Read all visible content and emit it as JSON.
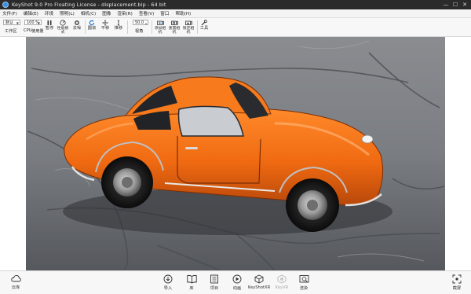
{
  "window": {
    "title": "KeyShot 9.0 Pro Floating License  -  displacement.bip  -  64 bit",
    "controls": [
      "—",
      "☐",
      "✕"
    ]
  },
  "menu": [
    "文件(F)",
    "编辑(E)",
    "环境",
    "照明(L)",
    "相机(C)",
    "图像",
    "渲染(R)",
    "查看(V)",
    "窗口",
    "帮助(H)"
  ],
  "toolbar": {
    "workspace_select": "默认",
    "workspace_label": "工作区",
    "cpu_label": "CPU",
    "cpu_usage_select": "100 %",
    "cpu_usage_label": "使用量",
    "pause_label": "暂停",
    "performance_mode_label": "性能模式",
    "denoise_label": "去噪",
    "flip_label": "翻滚",
    "pan_label": "平移",
    "dolly_label": "推移",
    "fov_value": "50.0",
    "fov_label": "视角",
    "add_camera_label": "添加相机",
    "reset_camera_label": "重置相机",
    "lock_camera_label": "锁定相机",
    "tools_label": "工具"
  },
  "bottom": {
    "cloud_label": "云库",
    "import_label": "导入",
    "library_label": "库",
    "project_label": "项目",
    "animation_label": "动画",
    "keyshotxr_label": "KeyShotXR",
    "keyvr_label": "KeyVR",
    "render_label": "渲染",
    "screenshot_label": "截屏"
  },
  "colors": {
    "car_body": "#f06a12",
    "titlebar": "#2b2b2b",
    "accent": "#1e78d2"
  }
}
